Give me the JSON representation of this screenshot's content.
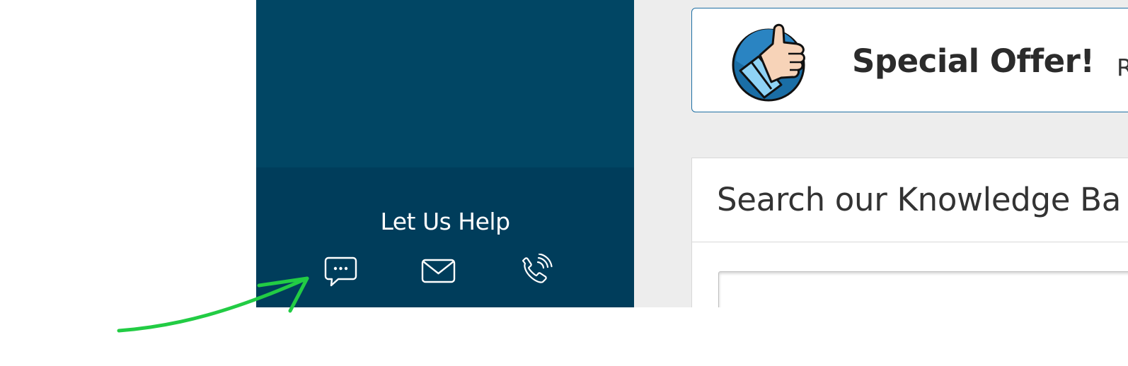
{
  "sidebar": {
    "help_title": "Let Us Help",
    "contact_icons": [
      "chat-bubble-icon",
      "envelope-icon",
      "phone-icon"
    ]
  },
  "offer": {
    "title": "Special Offer!",
    "trailing_text": "R",
    "icon": "thumbs-up-icon"
  },
  "knowledge_base": {
    "title": "Search our Knowledge Ba",
    "search_value": ""
  },
  "colors": {
    "sidebar_top": "#014664",
    "sidebar_help": "#003d5b",
    "content_bg": "#ededed",
    "offer_border": "#1e6fa3",
    "annotation_arrow": "#22cc44"
  }
}
